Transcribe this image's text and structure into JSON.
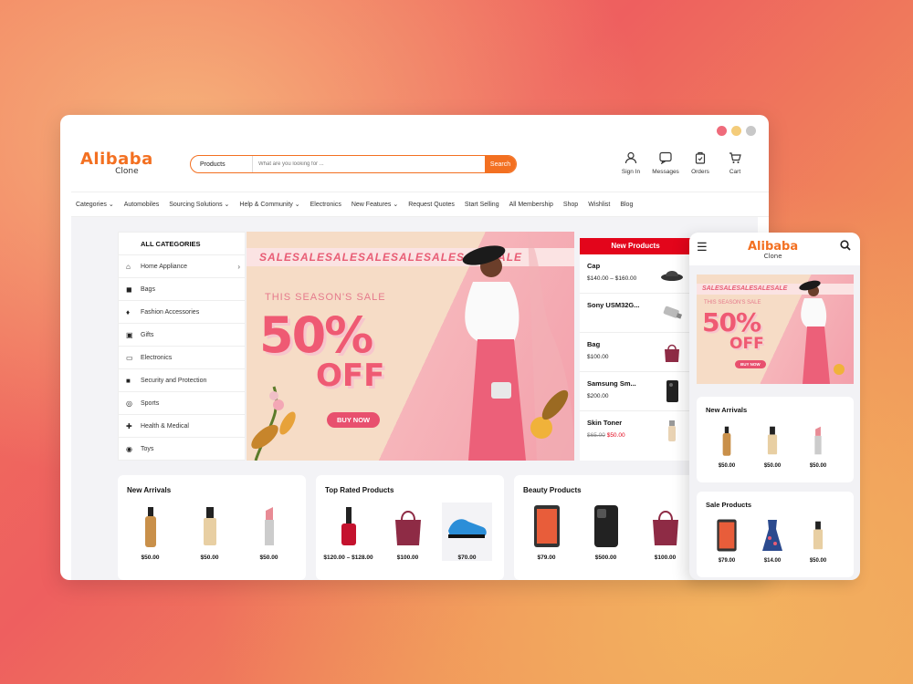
{
  "window_dots": [
    "#ef6b7b",
    "#f4cc7a",
    "#c8c8c8"
  ],
  "logo": {
    "line1": "Alibaba",
    "line2": "Clone"
  },
  "search": {
    "category": "Products",
    "placeholder": "What are you looking for ...",
    "button": "Search"
  },
  "header_icons": [
    {
      "icon": "user-icon",
      "label": "Sign In"
    },
    {
      "icon": "message-icon",
      "label": "Messages"
    },
    {
      "icon": "orders-icon",
      "label": "Orders"
    },
    {
      "icon": "cart-icon",
      "label": "Cart"
    }
  ],
  "nav": [
    "Categories",
    "Automobiles",
    "Sourcing Solutions",
    "Help & Community",
    "Electronics",
    "New Features",
    "Request Quotes",
    "Start Selling",
    "All Membership",
    "Shop",
    "Wishlist",
    "Blog"
  ],
  "categories": {
    "title": "ALL CATEGORIES",
    "items": [
      {
        "icon": "home-appliance-icon",
        "label": "Home Appliance"
      },
      {
        "icon": "bag-icon",
        "label": "Bags"
      },
      {
        "icon": "fashion-icon",
        "label": "Fashion Accessories"
      },
      {
        "icon": "gift-icon",
        "label": "Gifts"
      },
      {
        "icon": "laptop-icon",
        "label": "Electronics"
      },
      {
        "icon": "lock-icon",
        "label": "Security and Protection"
      },
      {
        "icon": "ball-icon",
        "label": "Sports"
      },
      {
        "icon": "health-icon",
        "label": "Health & Medical"
      },
      {
        "icon": "toys-icon",
        "label": "Toys"
      }
    ]
  },
  "banner": {
    "strip": "SALESALESALESALESALESALESALESALE",
    "season": "THIS SEASON'S SALE",
    "pct": "50%",
    "off": "OFF",
    "button": "BUY NOW"
  },
  "new_products": {
    "title": "New Products",
    "items": [
      {
        "name": "Cap",
        "price": "$140.00 – $160.00",
        "old": "",
        "icon": "cap-icon"
      },
      {
        "name": "Sony USM32G...",
        "price": "",
        "old": "",
        "icon": "usb-icon"
      },
      {
        "name": "Bag",
        "price": "$100.00",
        "old": "",
        "icon": "bag-icon"
      },
      {
        "name": "Samsung Sm...",
        "price": "$200.00",
        "old": "",
        "icon": "phone-icon"
      },
      {
        "name": "Skin Toner",
        "price": "$50.00",
        "old": "$65.00",
        "icon": "bottle-icon"
      }
    ]
  },
  "cards": [
    {
      "title": "New Arrivals",
      "items": [
        {
          "icon": "spray-bottle-icon",
          "price": "$50.00"
        },
        {
          "icon": "foundation-icon",
          "price": "$50.00"
        },
        {
          "icon": "lipstick-icon",
          "price": "$50.00"
        }
      ]
    },
    {
      "title": "Top Rated Products",
      "items": [
        {
          "icon": "nail-polish-icon",
          "price": "$120.00 – $128.00"
        },
        {
          "icon": "handbag-icon",
          "price": "$100.00"
        },
        {
          "icon": "sneaker-icon",
          "price": "$70.00"
        }
      ]
    },
    {
      "title": "Beauty Products",
      "items": [
        {
          "icon": "tablet-icon",
          "price": "$79.00"
        },
        {
          "icon": "phone-icon",
          "price": "$500.00"
        },
        {
          "icon": "handbag-icon",
          "price": "$100.00"
        }
      ]
    }
  ],
  "mobile": {
    "logo": {
      "line1": "Alibaba",
      "line2": "Clone"
    },
    "banner": {
      "strip": "SALESALESALESALESALE",
      "season": "THIS SEASON'S SALE",
      "pct": "50%",
      "off": "OFF",
      "button": "BUY NOW"
    },
    "new_arrivals": {
      "title": "New Arrivals",
      "prices": [
        "$50.00",
        "$50.00",
        "$50.00"
      ]
    },
    "sale_products": {
      "title": "Sale Products",
      "prices": [
        "$79.00",
        "$14.00",
        "$50.00"
      ]
    }
  }
}
